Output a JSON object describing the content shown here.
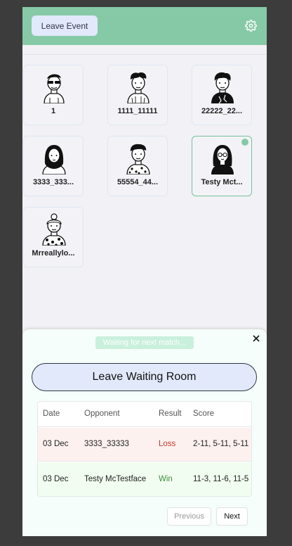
{
  "header": {
    "leave_event_label": "Leave Event",
    "settings_icon": "gear-icon",
    "bar_color": "#86c9a6"
  },
  "players": [
    {
      "name": "1",
      "avatar": "avatar-sunglasses-icon",
      "online": false,
      "selected": false
    },
    {
      "name": "1111_11111",
      "avatar": "avatar-curly-hair-icon",
      "online": false,
      "selected": false
    },
    {
      "name": "22222_22...",
      "avatar": "avatar-dark-hair-icon",
      "online": false,
      "selected": false
    },
    {
      "name": "3333_333...",
      "avatar": "avatar-hijab-icon",
      "online": false,
      "selected": false
    },
    {
      "name": "55554_44...",
      "avatar": "avatar-short-hair-icon",
      "online": false,
      "selected": false
    },
    {
      "name": "Testy Mct...",
      "avatar": "avatar-long-hair-glasses-icon",
      "online": true,
      "selected": true
    },
    {
      "name": "Mrreallylo...",
      "avatar": "avatar-bun-icon",
      "online": false,
      "selected": false
    }
  ],
  "waiting_room": {
    "status": "Waiting for next match...",
    "close_icon": "close-icon",
    "leave_label": "Leave Waiting Room",
    "table": {
      "headers": [
        "Date",
        "Opponent",
        "Result",
        "Score"
      ],
      "rows": [
        {
          "date": "03 Dec",
          "opponent": "3333_33333",
          "result": "Loss",
          "score": "2-11, 5-11, 5-11"
        },
        {
          "date": "03 Dec",
          "opponent": "Testy McTestface",
          "result": "Win",
          "score": "11-3, 11-6, 11-5"
        }
      ]
    },
    "pagination": {
      "previous": "Previous",
      "next": "Next"
    }
  }
}
